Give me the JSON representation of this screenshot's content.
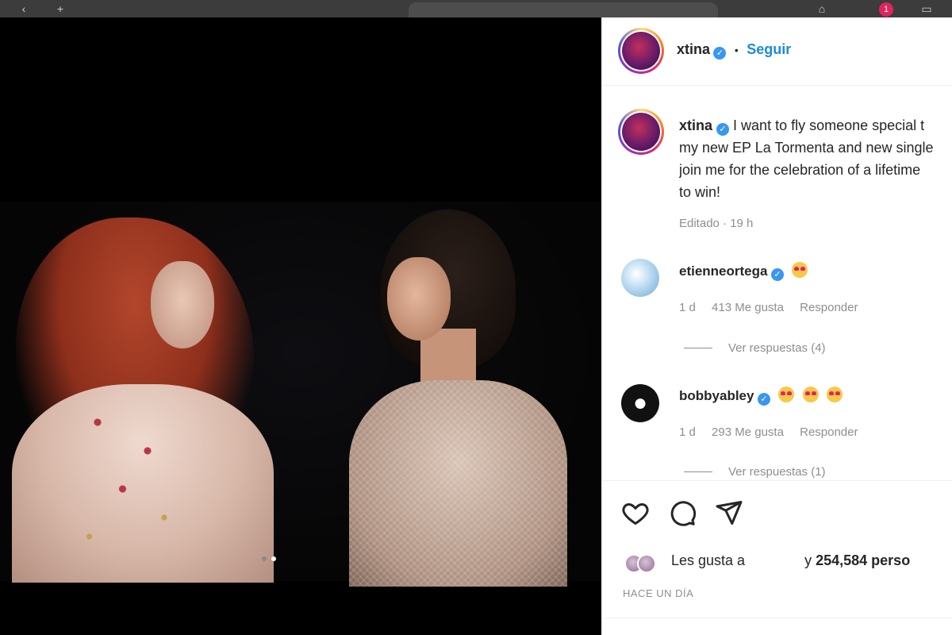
{
  "browser": {
    "notification_count": "1"
  },
  "post": {
    "carousel_dots": 2,
    "active_dot": 1
  },
  "header": {
    "username": "xtina",
    "separator": "•",
    "follow_label": "Seguir"
  },
  "caption": {
    "username": "xtina",
    "lines": [
      "I want to fly someone special t",
      "my new EP La Tormenta and new single",
      "join me for the celebration of a lifetime",
      "to win!"
    ],
    "edited_label": "Editado · 19 h"
  },
  "comments": [
    {
      "username": "etienneortega",
      "emoji_count": 1,
      "time": "1 d",
      "likes": "413 Me gusta",
      "reply_label": "Responder",
      "view_replies": "Ver respuestas (4)"
    },
    {
      "username": "bobbyabley",
      "emoji_count": 3,
      "time": "1 d",
      "likes": "293 Me gusta",
      "reply_label": "Responder",
      "view_replies": "Ver respuestas (1)"
    }
  ],
  "footer": {
    "likes_prefix": "Les gusta a",
    "likes_count": "254,584 perso",
    "likes_joiner": "y",
    "timestamp": "HACE UN DÍA"
  },
  "colors": {
    "follow_blue": "#1a8cd8",
    "verified_blue": "#3897f0",
    "muted_gray": "#8e8e8e"
  }
}
